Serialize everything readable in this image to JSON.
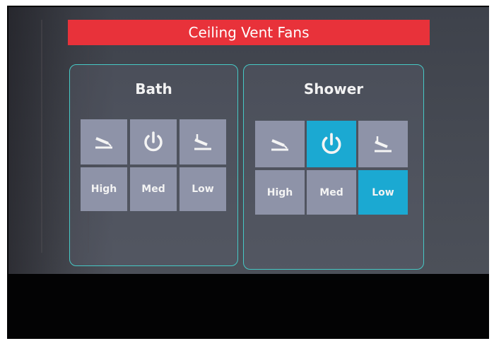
{
  "header": {
    "title": "Ceiling Vent Fans"
  },
  "zones": [
    {
      "name": "Bath",
      "icons": [
        "vent-open-icon",
        "power-icon",
        "vent-closed-icon"
      ],
      "speeds": [
        "High",
        "Med",
        "Low"
      ],
      "power_active": false,
      "active_speed": ""
    },
    {
      "name": "Shower",
      "icons": [
        "vent-open-icon",
        "power-icon",
        "vent-closed-icon"
      ],
      "speeds": [
        "High",
        "Med",
        "Low"
      ],
      "power_active": true,
      "active_speed": "Low"
    }
  ],
  "colors": {
    "title_bar": "#e8323a",
    "panel_border": "#46c9c6",
    "button": "#8e93a8",
    "button_active": "#1ba9d2",
    "screen_background": "#454952",
    "bezel": "#050506"
  }
}
